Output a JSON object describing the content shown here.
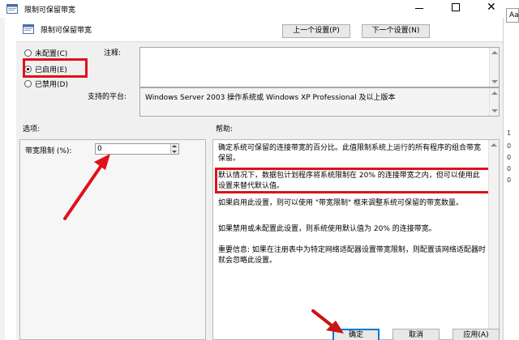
{
  "window": {
    "title": "限制可保留带宽",
    "close_glyph": "✕"
  },
  "right_peek": {
    "text": "Aa",
    "numbers": [
      "1",
      "0",
      "0",
      "0",
      "0"
    ]
  },
  "dialog": {
    "header_title": "限制可保留带宽",
    "prev_button": "上一个设置(P)",
    "next_button": "下一个设置(N)",
    "radios": {
      "not_configured": "未配置(C)",
      "enabled": "已启用(E)",
      "disabled": "已禁用(D)",
      "selected": "enabled"
    },
    "comment_label": "注释:",
    "platform_label": "支持的平台:",
    "platform_value": "Windows Server 2003 操作系统或 Windows XP Professional 及以上版本",
    "options_label": "选项:",
    "help_label": "帮助:",
    "bandwidth_label": "带宽限制 (%):",
    "bandwidth_value": "0",
    "help": {
      "p1": "确定系统可保留的连接带宽的百分比。此值限制系统上运行的所有程序的组合带宽保留。",
      "p2": "默认情况下，数据包计划程序将系统限制在 20% 的连接带宽之内，但可以使用此设置来替代默认值。",
      "p3": "如果启用此设置，则可以使用 \"带宽限制\" 框来调整系统可保留的带宽数量。",
      "p4": "如果禁用或未配置此设置，则系统使用默认值为 20% 的连接带宽。",
      "p5": "重要信息: 如果在注册表中为特定网络适配器设置带宽限制，则配置该网络适配器时就会忽略此设置。"
    },
    "ok_button": "确定",
    "cancel_button": "取消",
    "apply_button": "应用(A)"
  },
  "colors": {
    "highlight": "#e0111a",
    "focus": "#0078d7",
    "dialog_bg": "#f0f0f0"
  }
}
